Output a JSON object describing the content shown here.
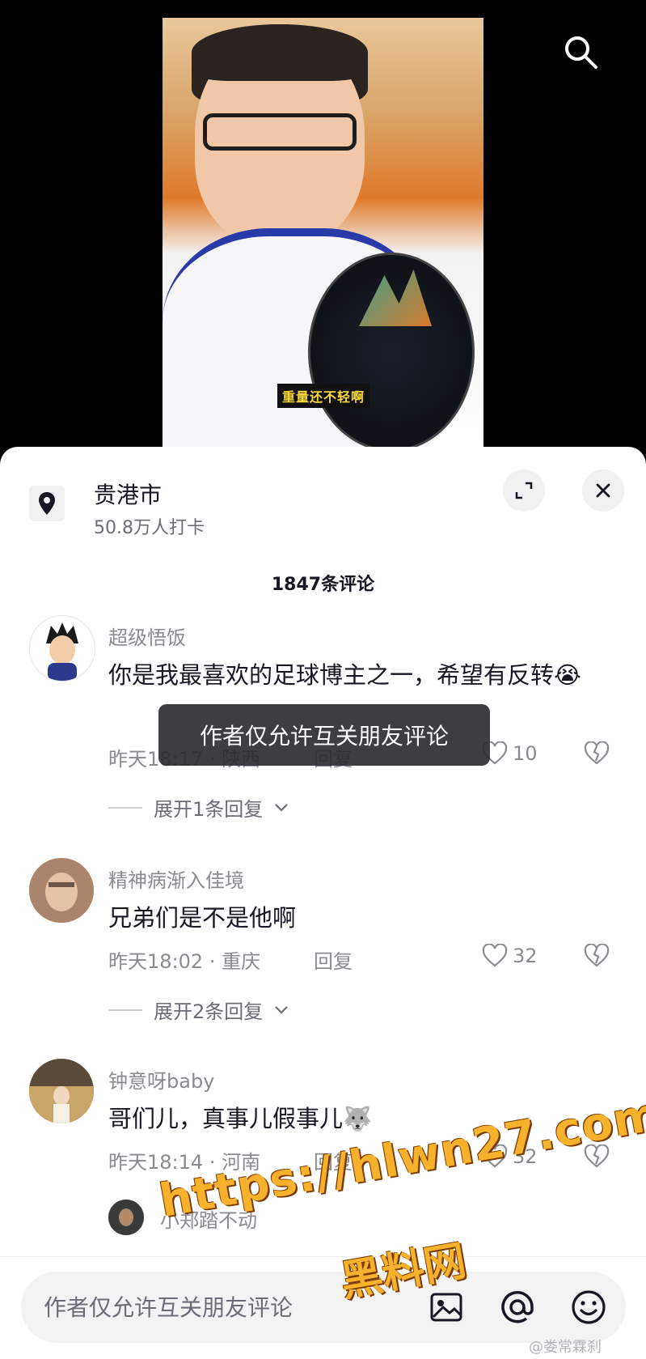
{
  "video": {
    "caption": "重量还不轻啊"
  },
  "location": {
    "name": "贵港市",
    "checkins": "50.8万人打卡"
  },
  "comments_header": {
    "count_label": "1847条评论"
  },
  "comments": [
    {
      "user": "超级悟饭",
      "text": "你是我最喜欢的足球博主之一，希望有反转😭",
      "time": "昨天18:17",
      "region": "陕西",
      "reply_label": "回复",
      "likes": "10",
      "expand_label": "展开1条回复"
    },
    {
      "user": "精神病渐入佳境",
      "text": "兄弟们是不是他啊",
      "time": "昨天18:02",
      "region": "重庆",
      "reply_label": "回复",
      "likes": "32",
      "expand_label": "展开2条回复"
    },
    {
      "user": "钟意呀baby",
      "text": "哥们儿，真事儿假事儿🐺",
      "time": "昨天18:14",
      "region": "河南",
      "reply_label": "回复",
      "likes": "32"
    }
  ],
  "partial_reply": {
    "user": "小郑踏不动"
  },
  "toast": {
    "text": "作者仅允许互关朋友评论"
  },
  "comment_input": {
    "placeholder": "作者仅允许互关朋友评论"
  },
  "watermark": {
    "url": "https://hlwn27.com",
    "name": "黑料网",
    "weibo": "@娄常霖刹"
  },
  "colors": {
    "text_primary": "#161823",
    "text_secondary": "#8a8b91",
    "caption_yellow": "#f7d83a",
    "watermark_orange": "#f6b22c"
  }
}
